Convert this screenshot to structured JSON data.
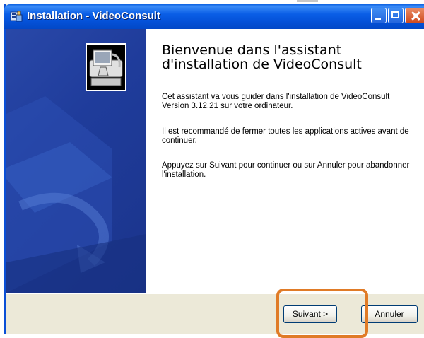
{
  "window": {
    "title": "Installation - VideoConsult",
    "title_icon": "installer-icon",
    "controls": [
      "minimize-button",
      "maximize-button",
      "close-button"
    ]
  },
  "wizard": {
    "heading": "Bienvenue dans l'assistant d'installation de VideoConsult",
    "paragraphs": [
      "Cet assistant va vous guider dans l'installation de VideoConsult Version 3.12.21 sur votre ordinateur.",
      "Il est recommandé de fermer toutes les applications actives avant de continuer.",
      "Appuyez sur Suivant pour continuer ou sur Annuler pour abandonner l'installation."
    ],
    "logo_icon": "computer-install-icon"
  },
  "buttons": {
    "next_label": "Suivant >",
    "cancel_label": "Annuler"
  },
  "colors": {
    "titlebar": "#0451d8",
    "side_panel": "#1f3c9b",
    "highlight": "#e07b27",
    "dialog_bg": "#ece9d8"
  }
}
